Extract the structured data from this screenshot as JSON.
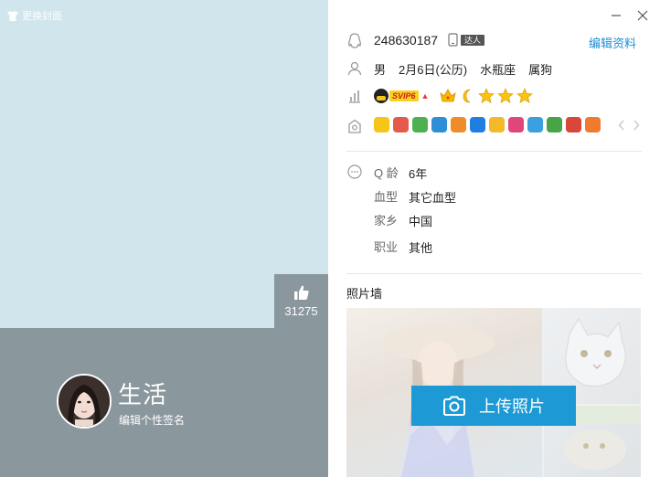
{
  "cover": {
    "change_label": "更换封面",
    "bg_color": "#d0e6ec",
    "like_count": "31275"
  },
  "profile": {
    "nickname": "生活",
    "signature_placeholder": "编辑个性签名",
    "qq_number": "248630187",
    "talent_badge": "达人",
    "edit_label": "编辑资料",
    "gender": "男",
    "birthday": "2月6日(公历)",
    "zodiac": "水瓶座",
    "chinese_zodiac": "属狗",
    "svip_label": "SVIP6",
    "level_icons": [
      "crown-icon",
      "moon-icon",
      "star-icon",
      "star-icon",
      "star-icon"
    ]
  },
  "services": [
    "penguin-icon",
    "game-icon",
    "pet-icon",
    "wallet-icon",
    "smile-icon",
    "shield-icon",
    "star-icon",
    "app-icon",
    "calendar-icon",
    "gift-icon",
    "ball-icon",
    "face-icon"
  ],
  "details": {
    "q_age_label": "Q 龄",
    "q_age_value": "6年",
    "blood_label": "血型",
    "blood_value": "其它血型",
    "hometown_label": "家乡",
    "hometown_value": "中国",
    "job_label": "职业",
    "job_value": "其他"
  },
  "photo_wall": {
    "title": "照片墙",
    "upload_label": "上传照片"
  },
  "colors": {
    "accent": "#1d9ad6",
    "panel_gray": "#8a979d",
    "link": "#1a8fd8"
  }
}
